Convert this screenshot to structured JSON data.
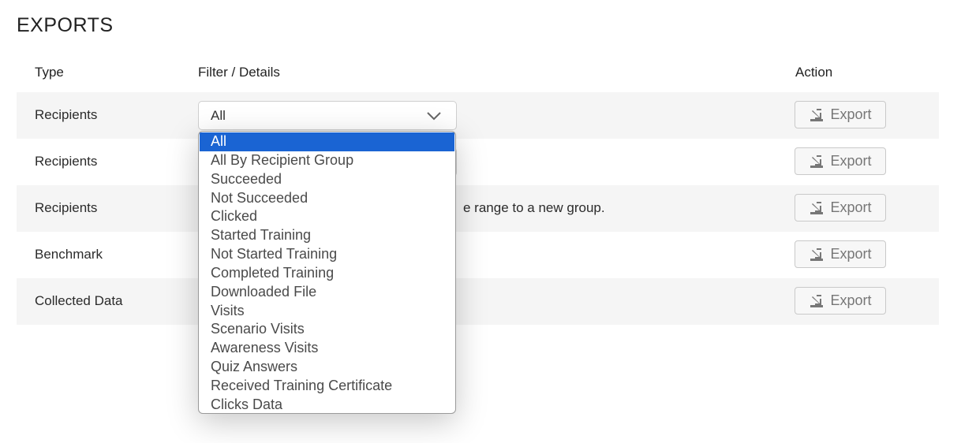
{
  "page_title": "EXPORTS",
  "table": {
    "headers": {
      "type": "Type",
      "filter": "Filter / Details",
      "action": "Action"
    },
    "rows": [
      {
        "type": "Recipients",
        "detail": "",
        "action": "Export"
      },
      {
        "type": "Recipients",
        "detail": "",
        "action": "Export"
      },
      {
        "type": "Recipients",
        "detail": "e range to a new group.",
        "action": "Export"
      },
      {
        "type": "Benchmark",
        "detail": "",
        "action": "Export"
      },
      {
        "type": "Collected Data",
        "detail": "",
        "action": "Export"
      }
    ]
  },
  "filter_select": {
    "value": "All",
    "options": [
      "All",
      "All By Recipient Group",
      "Succeeded",
      "Not Succeeded",
      "Clicked",
      "Started Training",
      "Not Started Training",
      "Completed Training",
      "Downloaded File",
      "Visits",
      "Scenario Visits",
      "Awareness Visits",
      "Quiz Answers",
      "Received Training Certificate",
      "Clicks Data"
    ],
    "selected_index": 0
  },
  "icons": {
    "export": "export-download-icon",
    "chevron": "chevron-down-icon"
  },
  "colors": {
    "selected_option": "#1a64d3",
    "row_shade": "#f5f5f5"
  }
}
